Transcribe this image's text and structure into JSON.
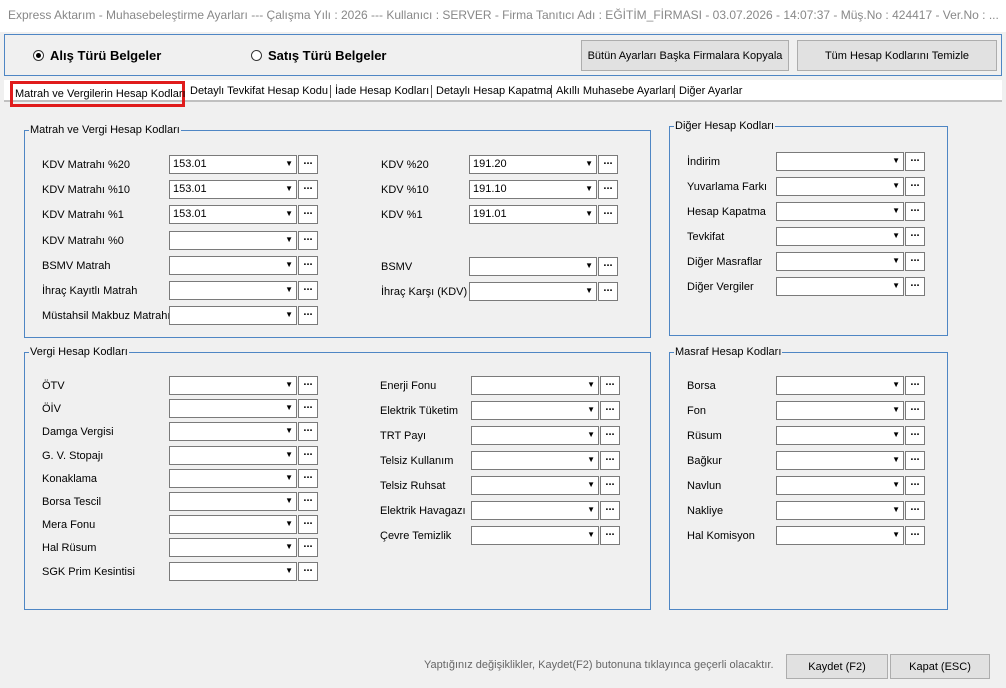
{
  "window": {
    "title": "Express Aktarım - Muhasebeleştirme Ayarları  ---  Çalışma Yılı : 2026  ---  Kullanıcı : SERVER - Firma Tanıtıcı Adı : EĞİTİM_FİRMASI - 03.07.2026 - 14:07:37 - Müş.No : 424417 - Ver.No : ..."
  },
  "top": {
    "radio_alis": "Alış Türü Belgeler",
    "radio_satis": "Satış Türü Belgeler",
    "copy_button": "Bütün Ayarları Başka Firmalara Kopyala",
    "clear_button": "Tüm Hesap Kodlarını Temizle"
  },
  "tabs": [
    {
      "label": "Matrah ve Vergilerin Hesap Kodları"
    },
    {
      "label": "Detaylı Tevkifat Hesap Kodu"
    },
    {
      "label": "İade Hesap Kodları"
    },
    {
      "label": "Detaylı Hesap Kapatma"
    },
    {
      "label": "Akıllı Muhasebe Ayarları"
    },
    {
      "label": "Diğer Ayarlar"
    }
  ],
  "matrah_group": {
    "title": "Matrah ve Vergi Hesap Kodları",
    "left": [
      {
        "label": "KDV Matrahı %20",
        "value": "153.01"
      },
      {
        "label": "KDV Matrahı %10",
        "value": "153.01"
      },
      {
        "label": "KDV Matrahı %1",
        "value": "153.01"
      },
      {
        "label": "KDV Matrahı %0",
        "value": ""
      },
      {
        "label": "BSMV Matrah",
        "value": ""
      },
      {
        "label": "İhraç Kayıtlı Matrah",
        "value": ""
      },
      {
        "label": "Müstahsil Makbuz Matrahı",
        "value": ""
      }
    ],
    "right": [
      {
        "label": "KDV %20",
        "value": "191.20"
      },
      {
        "label": "KDV %10",
        "value": "191.10"
      },
      {
        "label": "KDV %1",
        "value": "191.01"
      },
      {
        "label": "BSMV",
        "value": ""
      },
      {
        "label": "İhraç Karşı (KDV)",
        "value": ""
      }
    ]
  },
  "diger_group": {
    "title": "Diğer Hesap Kodları",
    "items": [
      {
        "label": "İndirim",
        "value": ""
      },
      {
        "label": "Yuvarlama Farkı",
        "value": ""
      },
      {
        "label": "Hesap Kapatma",
        "value": ""
      },
      {
        "label": "Tevkifat",
        "value": ""
      },
      {
        "label": "Diğer Masraflar",
        "value": ""
      },
      {
        "label": "Diğer Vergiler",
        "value": ""
      }
    ]
  },
  "vergi_group": {
    "title": "Vergi Hesap Kodları",
    "left": [
      {
        "label": "ÖTV",
        "value": ""
      },
      {
        "label": "ÖİV",
        "value": ""
      },
      {
        "label": "Damga Vergisi",
        "value": ""
      },
      {
        "label": "G. V. Stopajı",
        "value": ""
      },
      {
        "label": "Konaklama",
        "value": ""
      },
      {
        "label": "Borsa Tescil",
        "value": ""
      },
      {
        "label": "Mera Fonu",
        "value": ""
      },
      {
        "label": "Hal Rüsum",
        "value": ""
      },
      {
        "label": "SGK Prim Kesintisi",
        "value": ""
      }
    ],
    "right": [
      {
        "label": "Enerji Fonu",
        "value": ""
      },
      {
        "label": "Elektrik Tüketim",
        "value": ""
      },
      {
        "label": "TRT Payı",
        "value": ""
      },
      {
        "label": "Telsiz Kullanım",
        "value": ""
      },
      {
        "label": "Telsiz Ruhsat",
        "value": ""
      },
      {
        "label": "Elektrik Havagazı",
        "value": ""
      },
      {
        "label": "Çevre Temizlik",
        "value": ""
      }
    ]
  },
  "masraf_group": {
    "title": "Masraf Hesap Kodları",
    "items": [
      {
        "label": "Borsa",
        "value": ""
      },
      {
        "label": "Fon",
        "value": ""
      },
      {
        "label": "Rüsum",
        "value": ""
      },
      {
        "label": "Bağkur",
        "value": ""
      },
      {
        "label": "Navlun",
        "value": ""
      },
      {
        "label": "Nakliye",
        "value": ""
      },
      {
        "label": "Hal Komisyon",
        "value": ""
      }
    ]
  },
  "footer": {
    "note": "Yaptığınız değişiklikler, Kaydet(F2) butonuna tıklayınca geçerli olacaktır.",
    "save_button": "Kaydet (F2)",
    "close_button": "Kapat (ESC)"
  },
  "icons": {
    "dropdown": "chevron-down-icon",
    "browse": "ellipsis-icon"
  },
  "colors": {
    "group_border": "#4e86c4",
    "active_tab_highlight": "#e01c1c"
  }
}
